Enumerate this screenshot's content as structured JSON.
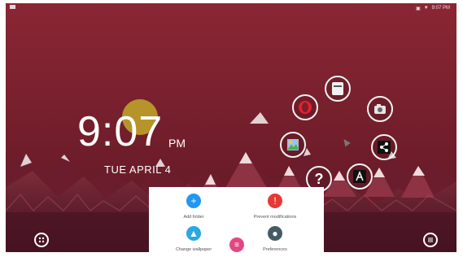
{
  "status": {
    "time": "9:07 PM"
  },
  "lockscreen": {
    "time": "9:07",
    "ampm": "PM",
    "date": "TUE APRIL 4"
  },
  "apps": {
    "opera": "Opera",
    "files": "Files",
    "camera": "Camera",
    "gallery": "Gallery",
    "share": "Share",
    "help": "?",
    "launcher": "Launcher"
  },
  "tray": {
    "add_folder": "Add folder",
    "prevent_modifications": "Prevent modifications",
    "change_wallpaper": "Change wallpaper",
    "preferences": "Preferences"
  },
  "colors": {
    "add_folder": "#2196f3",
    "prevent_modifications": "#e53935",
    "change_wallpaper": "#29a9e1",
    "preferences": "#455a64",
    "tray_menu": "#e54583"
  }
}
